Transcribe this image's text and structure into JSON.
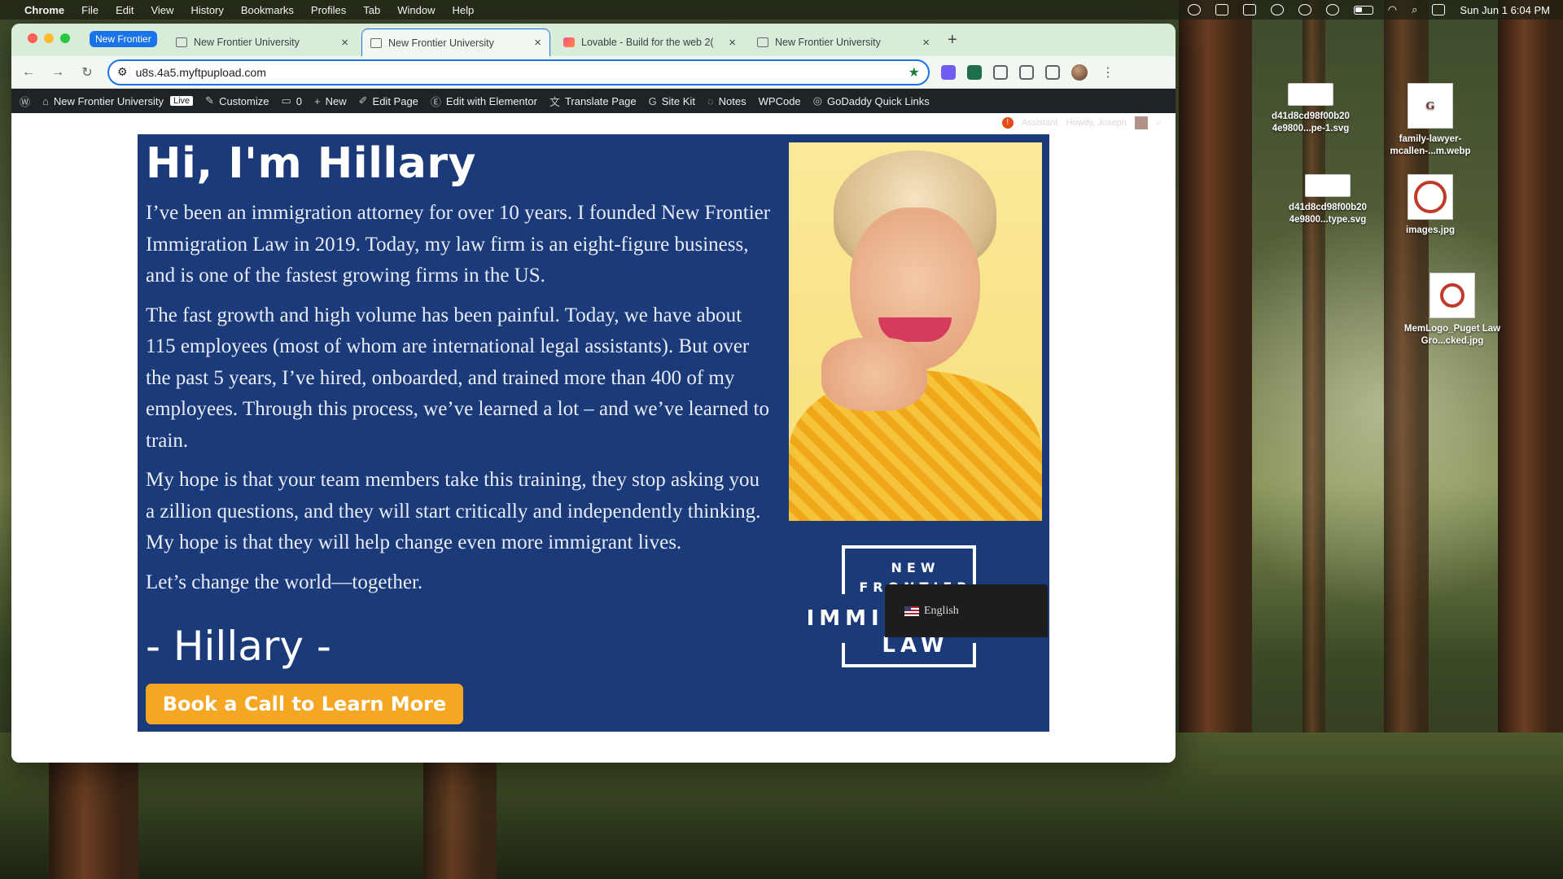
{
  "menubar": {
    "app": "Chrome",
    "items": [
      "File",
      "Edit",
      "View",
      "History",
      "Bookmarks",
      "Profiles",
      "Tab",
      "Window",
      "Help"
    ],
    "datetime": "Sun Jun 1  6:04 PM"
  },
  "browser": {
    "tab_group": "New Frontier",
    "tabs": [
      {
        "title": "New Frontier University",
        "active": false
      },
      {
        "title": "New Frontier University",
        "active": true
      },
      {
        "title": "Lovable - Build for the web 2(",
        "active": false
      },
      {
        "title": "New Frontier University",
        "active": false
      }
    ],
    "url": "u8s.4a5.myftpupload.com"
  },
  "wpbar": {
    "site": "New Frontier University",
    "live": "Live",
    "customize": "Customize",
    "comments": "0",
    "new": "New",
    "edit_page": "Edit Page",
    "elementor": "Edit with Elementor",
    "translate": "Translate Page",
    "sitekit": "Site Kit",
    "notes": "Notes",
    "wpcode": "WPCode",
    "godaddy": "GoDaddy Quick Links",
    "assistant": "Assistant",
    "howdy": "Howdy, Joseph"
  },
  "hero": {
    "heading": "Hi, I'm Hillary",
    "paragraphs": [
      "I’ve been an immigration attorney for over 10 years. I founded New Frontier Immigration Law in 2019. Today, my law firm is an eight-figure business, and is one of the fastest growing firms in the US.",
      "The fast growth and high volume has been painful. Today, we have about 115 employees (most of whom are international legal assistants). But over the past 5 years, I’ve hired, onboarded, and trained more than 400 of my employees. Through this process, we’ve learned a lot – and we’ve learned to train.",
      "My hope is that your team members take this training, they stop asking you a zillion questions, and they will start critically and independently thinking. My hope is that they will help change even more immigrant lives.",
      "Let’s change the world—together."
    ],
    "signature": "- Hillary -",
    "cta": "Book a Call to Learn More"
  },
  "logo": {
    "line1": "NEW",
    "line2": "FRONTIER",
    "line3": "IMMIGRATION",
    "line4": "LAW"
  },
  "language": "English",
  "desktop": [
    {
      "name": "d41d8cd98f00b20 4e9800...pe-1.svg"
    },
    {
      "name": "family-lawyer-mcallen-...m.webp"
    },
    {
      "name": "d41d8cd98f00b20 4e9800...type.svg"
    },
    {
      "name": "images.jpg"
    },
    {
      "name": "MemLogo_Puget Law Gro...cked.jpg"
    }
  ]
}
